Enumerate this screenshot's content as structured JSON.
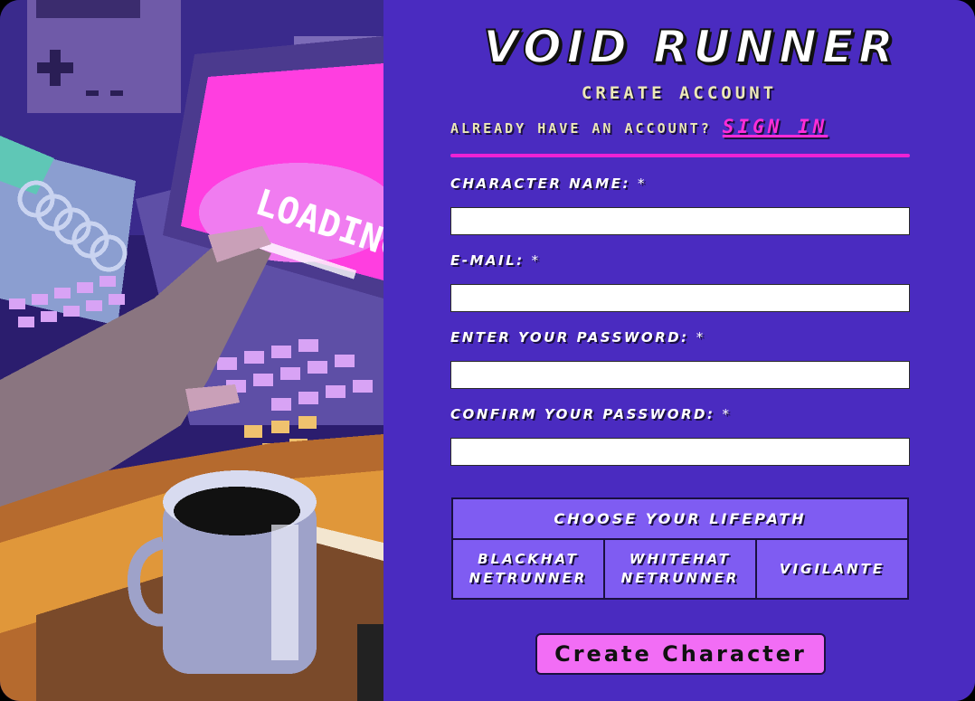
{
  "header": {
    "title": "VOID RUNNER",
    "subtitle": "CREATE ACCOUNT",
    "signin_prompt": "ALREADY HAVE AN ACCOUNT?",
    "signin_link": "SIGN IN"
  },
  "art": {
    "screen_text": "LOADING"
  },
  "form": {
    "fields": [
      {
        "label": "CHARACTER NAME:",
        "required": "*",
        "value": "",
        "placeholder": ""
      },
      {
        "label": "E-MAIL:",
        "required": "*",
        "value": "",
        "placeholder": ""
      },
      {
        "label": "ENTER YOUR PASSWORD:",
        "required": "*",
        "value": "",
        "placeholder": ""
      },
      {
        "label": "CONFIRM YOUR PASSWORD:",
        "required": "*",
        "value": "",
        "placeholder": ""
      }
    ],
    "lifepath": {
      "heading": "CHOOSE YOUR LIFEPATH",
      "options": [
        "BLACKHAT\nNETRUNNER",
        "WHITEHAT\nNETRUNNER",
        "VIGILANTE"
      ]
    },
    "submit_label": "Create Character"
  },
  "colors": {
    "panel_bg": "#4a2bc0",
    "accent_pink": "#ee22d4",
    "button_pink": "#f26df5",
    "lifepath_bg": "#7f5cf2",
    "text_cream": "#ece8b8"
  }
}
